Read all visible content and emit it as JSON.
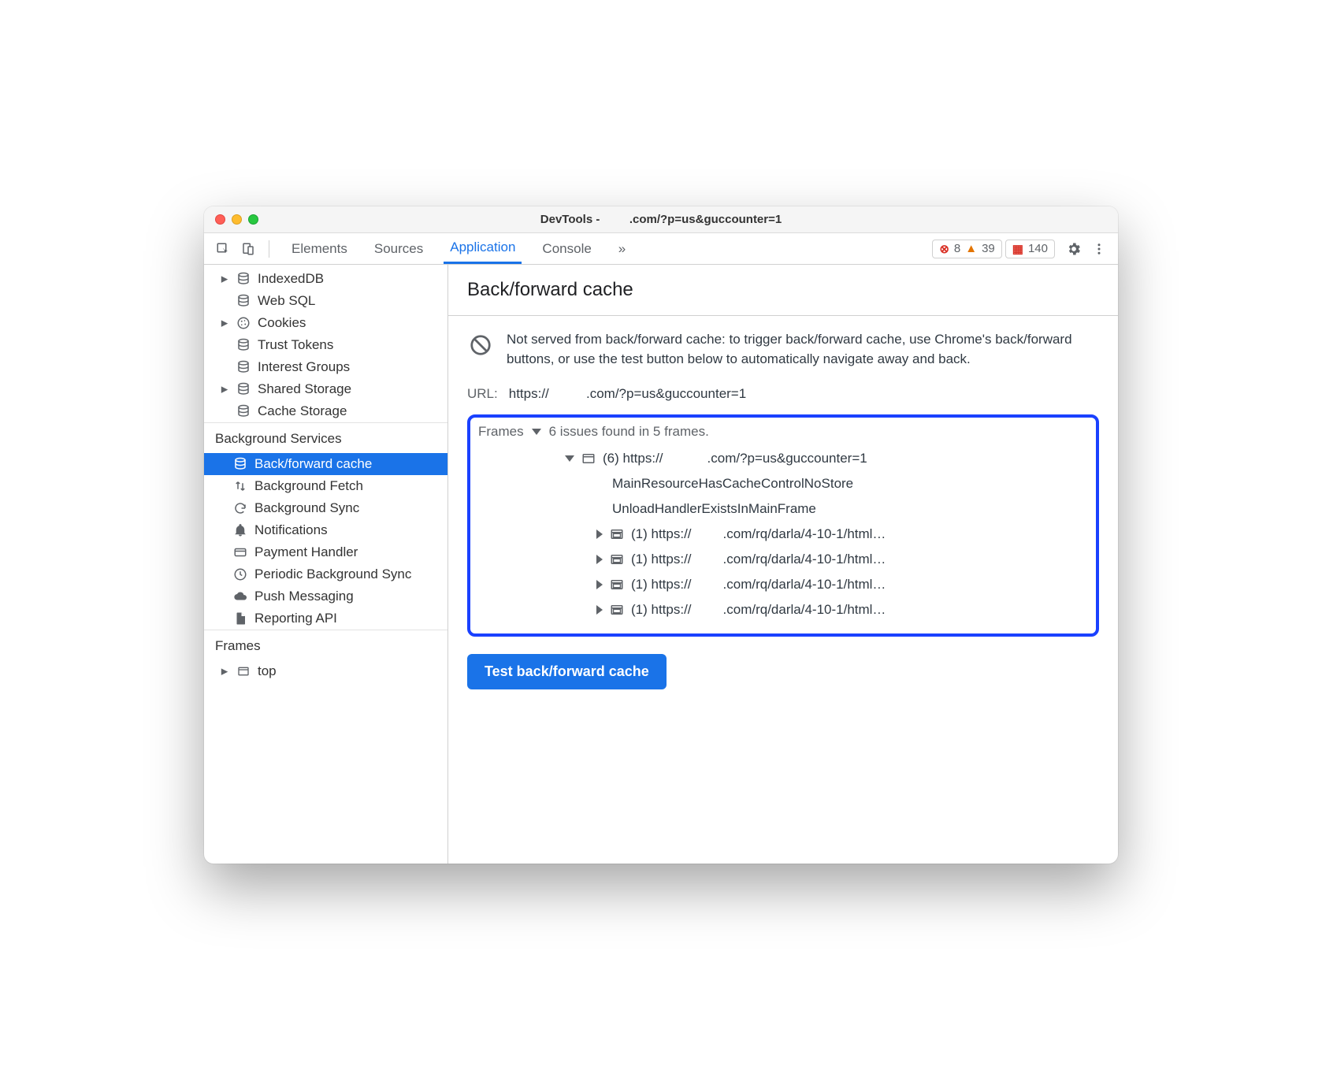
{
  "window": {
    "title_prefix": "DevTools - ",
    "title_suffix": ".com/?p=us&guccounter=1"
  },
  "toolbar": {
    "tabs": [
      "Elements",
      "Sources",
      "Application",
      "Console"
    ],
    "active_tab": "Application",
    "more": "»",
    "errors": 8,
    "warnings": 39,
    "messages": 140
  },
  "sidebar": {
    "storage_items": [
      {
        "label": "IndexedDB",
        "icon": "database",
        "expandable": true
      },
      {
        "label": "Web SQL",
        "icon": "database",
        "expandable": false
      },
      {
        "label": "Cookies",
        "icon": "cookie",
        "expandable": true
      },
      {
        "label": "Trust Tokens",
        "icon": "database",
        "expandable": false
      },
      {
        "label": "Interest Groups",
        "icon": "database",
        "expandable": false
      },
      {
        "label": "Shared Storage",
        "icon": "database",
        "expandable": true
      },
      {
        "label": "Cache Storage",
        "icon": "database",
        "expandable": false
      }
    ],
    "bg_title": "Background Services",
    "bg_items": [
      {
        "label": "Back/forward cache",
        "icon": "database",
        "selected": true
      },
      {
        "label": "Background Fetch",
        "icon": "updown"
      },
      {
        "label": "Background Sync",
        "icon": "sync"
      },
      {
        "label": "Notifications",
        "icon": "bell"
      },
      {
        "label": "Payment Handler",
        "icon": "card"
      },
      {
        "label": "Periodic Background Sync",
        "icon": "clock"
      },
      {
        "label": "Push Messaging",
        "icon": "cloud"
      },
      {
        "label": "Reporting API",
        "icon": "file"
      }
    ],
    "frames_title": "Frames",
    "frames_root": "top"
  },
  "pane": {
    "title": "Back/forward cache",
    "status": "Not served from back/forward cache: to trigger back/forward cache, use Chrome's back/forward buttons, or use the test button below to automatically navigate away and back.",
    "url_label": "URL:",
    "url_prefix": "https://",
    "url_suffix": ".com/?p=us&guccounter=1",
    "frames_label": "Frames",
    "frames_summary": "6 issues found in 5 frames.",
    "root_frame_prefix": "(6) https://",
    "root_frame_suffix": ".com/?p=us&guccounter=1",
    "reasons": [
      "MainResourceHasCacheControlNoStore",
      "UnloadHandlerExistsInMainFrame"
    ],
    "subframes": [
      {
        "prefix": "(1) https://",
        "suffix": ".com/rq/darla/4-10-1/html…"
      },
      {
        "prefix": "(1) https://",
        "suffix": ".com/rq/darla/4-10-1/html…"
      },
      {
        "prefix": "(1) https://",
        "suffix": ".com/rq/darla/4-10-1/html…"
      },
      {
        "prefix": "(1) https://",
        "suffix": ".com/rq/darla/4-10-1/html…"
      }
    ],
    "button": "Test back/forward cache"
  }
}
